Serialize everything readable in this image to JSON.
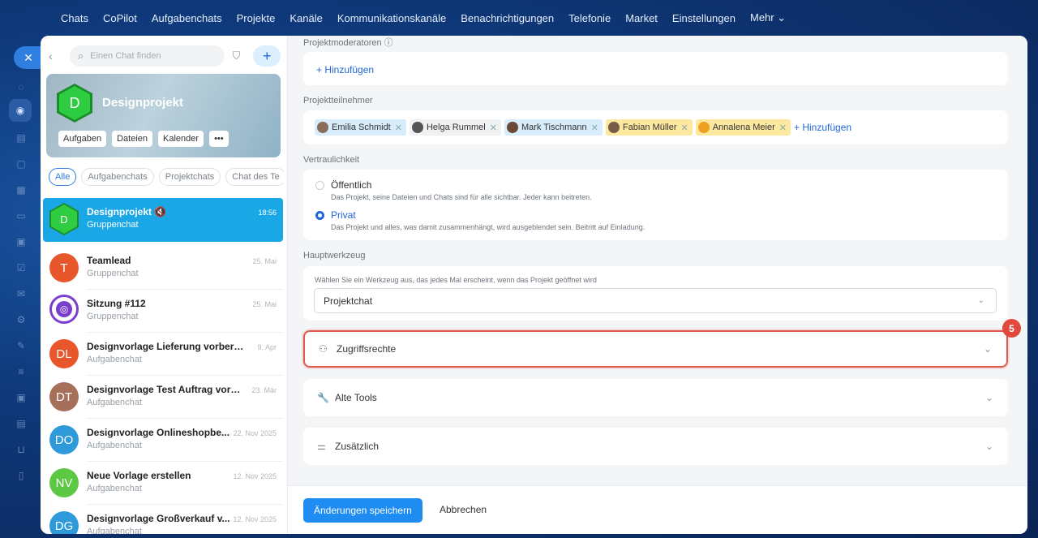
{
  "topnav": [
    "Chats",
    "CoPilot",
    "Aufgabenchats",
    "Projekte",
    "Kanäle",
    "Kommunikationskanäle",
    "Benachrichtigungen",
    "Telefonie",
    "Market",
    "Einstellungen",
    "Mehr ⌄"
  ],
  "close_glyph": "✕",
  "search": {
    "placeholder": "Einen Chat finden"
  },
  "hero": {
    "initial": "D",
    "title": "Designprojekt",
    "buttons": [
      "Aufgaben",
      "Dateien",
      "Kalender",
      "•••"
    ]
  },
  "filter_tabs": [
    "Alle",
    "Aufgabenchats",
    "Projektchats",
    "Chat des Te"
  ],
  "chats": [
    {
      "initial": "D",
      "name": "Designprojekt 🔇",
      "sub": "Gruppenchat",
      "time": "18:56",
      "color": "#2ecc40"
    },
    {
      "initial": "T",
      "name": "Teamlead",
      "sub": "Gruppenchat",
      "time": "25. Mai",
      "color": "#e8572c"
    },
    {
      "initial": "",
      "name": "Sitzung #112",
      "sub": "Gruppenchat",
      "time": "25. Mai",
      "color": "#7b3fd0"
    },
    {
      "initial": "DL",
      "name": "Designvorlage Lieferung vorbereiten",
      "sub": "Aufgabenchat",
      "time": "9. Apr",
      "color": "#e8572c"
    },
    {
      "initial": "DT",
      "name": "Designvorlage Test Auftrag vorbe...",
      "sub": "Aufgabenchat",
      "time": "23. Mär",
      "color": "#a66f5a"
    },
    {
      "initial": "DO",
      "name": "Designvorlage Onlineshopbe...",
      "sub": "Aufgabenchat",
      "time": "22. Nov 2025",
      "color": "#2f9ad9"
    },
    {
      "initial": "NV",
      "name": "Neue Vorlage erstellen",
      "sub": "Aufgabenchat",
      "time": "12. Nov 2025",
      "color": "#5cc843"
    },
    {
      "initial": "DG",
      "name": "Designvorlage Großverkauf v...",
      "sub": "Aufgabenchat",
      "time": "12. Nov 2025",
      "color": "#2f9ad9"
    }
  ],
  "settings": {
    "moderators_label": "Projektmoderatoren ⓘ",
    "add_label": "+ Hinzufügen",
    "participants_label": "Projektteilnehmer",
    "participants": [
      {
        "name": "Emilia Schmidt",
        "style": "blue"
      },
      {
        "name": "Helga Rummel",
        "style": "grey"
      },
      {
        "name": "Mark Tischmann",
        "style": "blue"
      },
      {
        "name": "Fabian Müller",
        "style": "yellow"
      },
      {
        "name": "Annalena Meier",
        "style": "yellow"
      }
    ],
    "privacy_label": "Vertraulichkeit",
    "privacy_options": [
      {
        "title": "Öffentlich",
        "desc": "Das Projekt, seine Dateien und Chats sind für alle sichtbar. Jeder kann beitreten.",
        "selected": false
      },
      {
        "title": "Privat",
        "desc": "Das Projekt und alles, was damit zusammenhängt, wird ausgeblendet sein. Beitritt auf Einladung.",
        "selected": true
      }
    ],
    "tool_label": "Hauptwerkzeug",
    "tool_hint": "Wählen Sie ein Werkzeug aus, das jedes Mal erscheint, wenn das Projekt geöffnet wird",
    "tool_value": "Projektchat",
    "accordions": [
      "Zugriffsrechte",
      "Alte Tools",
      "Zusätzlich"
    ],
    "step_badge": "5"
  },
  "footer": {
    "save": "Änderungen speichern",
    "cancel": "Abbrechen"
  },
  "colors": {
    "accent": "#1e8cf0",
    "highlight": "#e05a4b"
  }
}
